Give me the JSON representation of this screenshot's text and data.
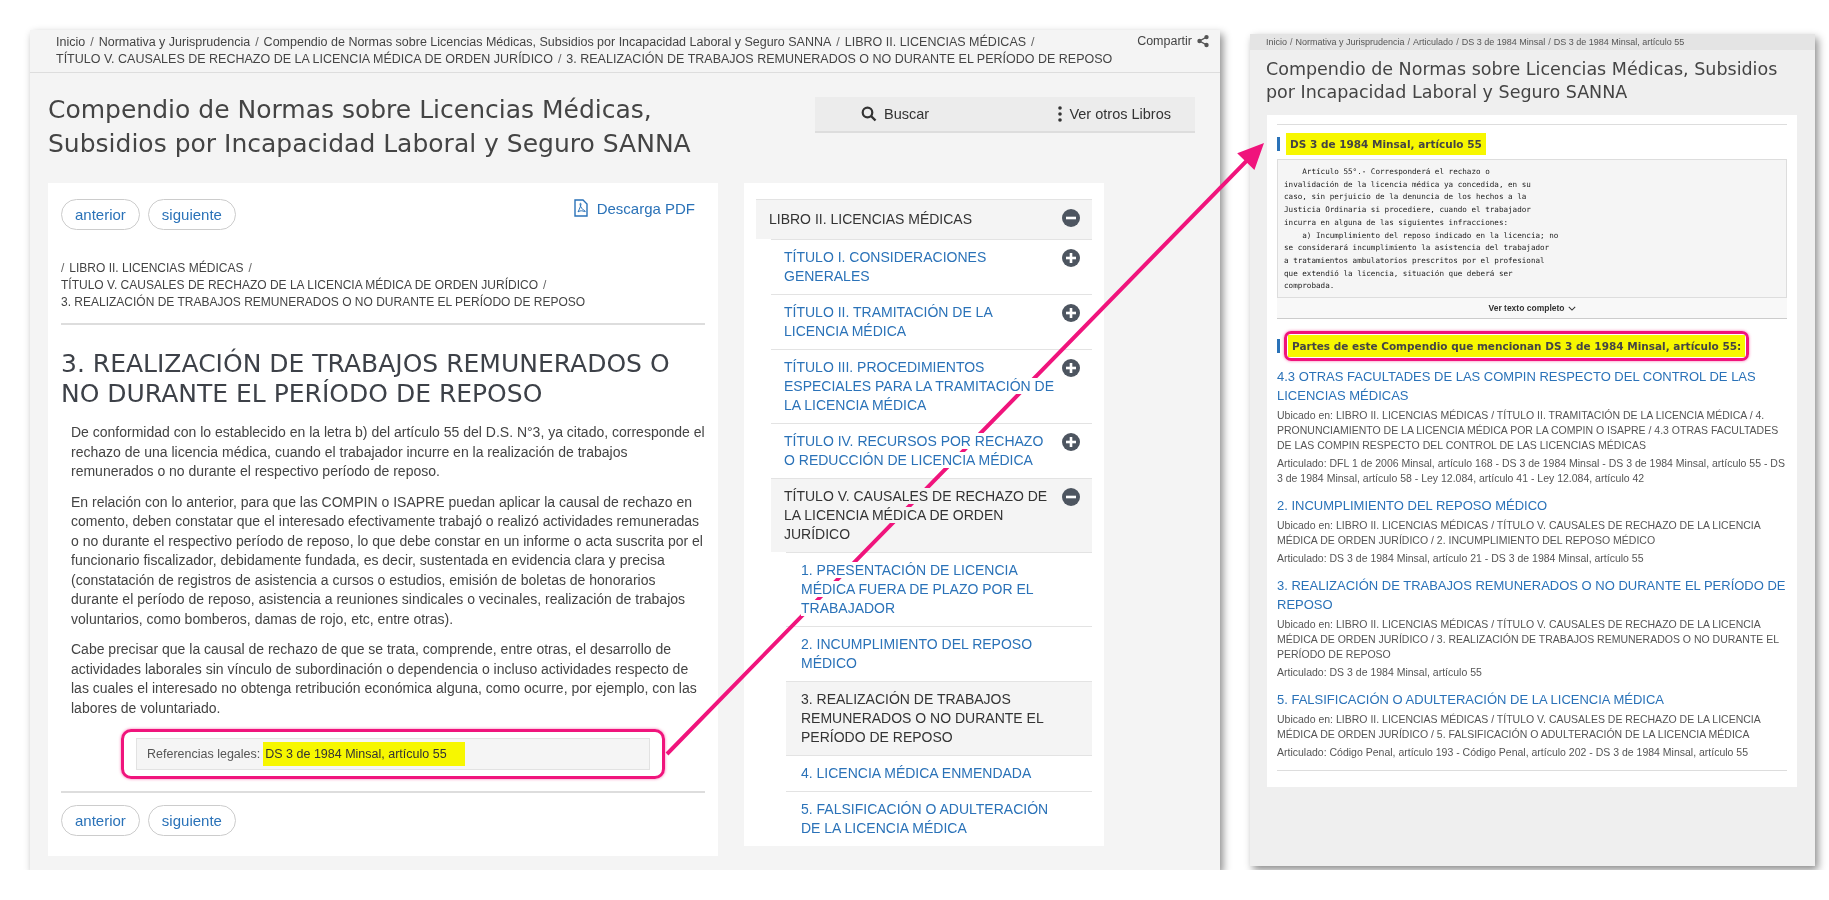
{
  "annotation_arrow": true,
  "left_page": {
    "breadcrumb": {
      "separator": "/",
      "items": [
        "Inicio",
        "Normativa y Jurisprudencia",
        "Compendio de Normas sobre Licencias Médicas, Subsidios por Incapacidad Laboral y Seguro SANNA",
        "LIBRO II. LICENCIAS MÉDICAS",
        "TÍTULO V. CAUSALES DE RECHAZO DE LA LICENCIA MÉDICA DE ORDEN JURÍDICO",
        "3. REALIZACIÓN DE TRABAJOS REMUNERADOS O NO DURANTE EL PERÍODO DE REPOSO"
      ]
    },
    "share": "Compartir",
    "title": "Compendio de Normas sobre Licencias Médicas, Subsidios por Incapacidad Laboral y Seguro SANNA",
    "tools": [
      {
        "kind": "search",
        "label": "Buscar"
      },
      {
        "kind": "more",
        "label": "Ver otros Libros"
      }
    ],
    "content": {
      "nav_top": [
        "anterior",
        "siguiente"
      ],
      "download": "Descarga PDF",
      "breadcrumb": {
        "separator": "/",
        "leading_separator": true,
        "items": [
          "LIBRO II. LICENCIAS MÉDICAS",
          "TÍTULO V. CAUSALES DE RECHAZO DE LA LICENCIA MÉDICA DE ORDEN JURÍDICO",
          "3. REALIZACIÓN DE TRABAJOS REMUNERADOS O NO DURANTE EL PERÍODO DE REPOSO"
        ]
      },
      "heading": "3. REALIZACIÓN DE TRABAJOS REMUNERADOS O NO DURANTE EL PERÍODO DE REPOSO",
      "paragraphs": [
        "De conformidad con lo establecido en la letra b) del artículo 55 del D.S. N°3, ya citado, corresponde el rechazo de una licencia médica, cuando el trabajador incurre en la realización de trabajos remunerados o no durante el respectivo período de reposo.",
        "En relación con lo anterior, para que las COMPIN o ISAPRE puedan aplicar la causal de rechazo en comento, deben constatar que el interesado efectivamente trabajó o realizó actividades remuneradas o no durante el respectivo período de reposo, lo que debe constar en un informe o acta suscrita por el funcionario fiscalizador, debidamente fundada, es decir, sustentada en evidencia clara y precisa (constatación de registros de asistencia a cursos o estudios, emisión de boletas de honorarios durante el período de reposo, asistencia a reuniones sindicales o vecinales, realización de trabajos voluntarios, como bomberos, damas de rojo, etc, entre otras).",
        "Cabe precisar que la causal de rechazo de que se trata, comprende, entre otras, el desarrollo de actividades laborales sin vínculo de subordinación o dependencia o incluso actividades respecto de las cuales el interesado no obtenga retribución económica alguna, como ocurre, por ejemplo, con las labores de voluntariado."
      ],
      "references": {
        "label": "Referencias legales:",
        "link": "DS 3 de 1984 Minsal, artículo 55",
        "highlighted": true,
        "framed": true
      },
      "nav_bottom": [
        "anterior",
        "siguiente"
      ]
    },
    "sidebar": {
      "items": [
        {
          "label": "LIBRO II. LICENCIAS MÉDICAS",
          "expanded": true,
          "children": [
            {
              "label": "TÍTULO I. CONSIDERACIONES GENERALES",
              "expanded": false
            },
            {
              "label": "TÍTULO II. TRAMITACIÓN DE LA LICENCIA MÉDICA",
              "expanded": false
            },
            {
              "label": "TÍTULO III. PROCEDIMIENTOS ESPECIALES PARA LA TRAMITACIÓN DE LA LICENCIA MÉDICA",
              "expanded": false
            },
            {
              "label": "TÍTULO IV. RECURSOS POR RECHAZO O REDUCCIÓN DE LICENCIA MÉDICA",
              "expanded": false
            },
            {
              "label": "TÍTULO V. CAUSALES DE RECHAZO DE LA LICENCIA MÉDICA DE ORDEN JURÍDICO",
              "expanded": true,
              "children": [
                {
                  "label": "1. PRESENTACIÓN DE LICENCIA MÉDICA FUERA DE PLAZO POR EL TRABAJADOR",
                  "selected": false
                },
                {
                  "label": "2. INCUMPLIMIENTO DEL REPOSO MÉDICO",
                  "selected": false
                },
                {
                  "label": "3. REALIZACIÓN DE TRABAJOS REMUNERADOS O NO DURANTE EL PERÍODO DE REPOSO",
                  "selected": true
                },
                {
                  "label": "4. LICENCIA MÉDICA ENMENDADA",
                  "selected": false
                },
                {
                  "label": "5. FALSIFICACIÓN O ADULTERACIÓN DE LA LICENCIA MÉDICA",
                  "selected": false
                }
              ]
            }
          ]
        }
      ]
    }
  },
  "right_page": {
    "breadcrumb": {
      "separator": "/",
      "items": [
        "Inicio",
        "Normativa y Jurisprudencia",
        "Articulado",
        "DS 3 de 1984 Minsal",
        "DS 3 de 1984 Minsal, artículo 55"
      ]
    },
    "title": "Compendio de Normas sobre Licencias Médicas, Subsidios por Incapacidad Laboral y Seguro SANNA",
    "article": {
      "heading": "DS 3 de 1984 Minsal, artículo 55",
      "highlighted": true,
      "text": "    Artículo 55°.- Corresponderá el rechazo o\ninvalidación de la licencia médica ya concedida, en su\ncaso, sin perjuicio de la denuncia de los hechos a la\nJusticia Ordinaria si procediere, cuando el trabajador\nincurra en alguna de las siguientes infracciones:\n    a) Incumplimiento del reposo indicado en la licencia; no\nse considerará incumplimiento la asistencia del trabajador\na tratamientos ambulatorios prescritos por el profesional\nque extendió la licencia, situación que deberá ser\ncomprobada.",
      "expand_label": "Ver texto completo"
    },
    "mentions": {
      "heading": "Partes de este Compendio que mencionan DS 3 de 1984 Minsal, artículo 55:",
      "highlighted": true,
      "framed": true,
      "results": [
        {
          "title": "4.3 OTRAS FACULTADES DE LAS COMPIN RESPECTO DEL CONTROL DE LAS LICENCIAS MÉDICAS",
          "location": "Ubicado en: LIBRO II. LICENCIAS MÉDICAS / TÍTULO II. TRAMITACIÓN DE LA LICENCIA MÉDICA / 4. PRONUNCIAMIENTO DE LA LICENCIA MÉDICA POR LA COMPIN O ISAPRE / 4.3 OTRAS FACULTADES DE LAS COMPIN RESPECTO DEL CONTROL DE LAS LICENCIAS MÉDICAS",
          "articles": "Articulado: DFL 1 de 2006 Minsal, artículo 168 - DS 3 de 1984 Minsal - DS 3 de 1984 Minsal, artículo 55 - DS 3 de 1984 Minsal, artículo 58 - Ley 12.084, artículo 41 - Ley 12.084, artículo 42"
        },
        {
          "title": "2. INCUMPLIMIENTO DEL REPOSO MÉDICO",
          "location": "Ubicado en: LIBRO II. LICENCIAS MÉDICAS / TÍTULO V. CAUSALES DE RECHAZO DE LA LICENCIA MÉDICA DE ORDEN JURÍDICO / 2. INCUMPLIMIENTO DEL REPOSO MÉDICO",
          "articles": "Articulado: DS 3 de 1984 Minsal, artículo 21 - DS 3 de 1984 Minsal, artículo 55"
        },
        {
          "title": "3. REALIZACIÓN DE TRABAJOS REMUNERADOS O NO DURANTE EL PERÍODO DE REPOSO",
          "location": "Ubicado en: LIBRO II. LICENCIAS MÉDICAS / TÍTULO V. CAUSALES DE RECHAZO DE LA LICENCIA MÉDICA DE ORDEN JURÍDICO / 3. REALIZACIÓN DE TRABAJOS REMUNERADOS O NO DURANTE EL PERÍODO DE REPOSO",
          "articles": "Articulado: DS 3 de 1984 Minsal, artículo 55"
        },
        {
          "title": "5. FALSIFICACIÓN O ADULTERACIÓN DE LA LICENCIA MÉDICA",
          "location": "Ubicado en: LIBRO II. LICENCIAS MÉDICAS / TÍTULO V. CAUSALES DE RECHAZO DE LA LICENCIA MÉDICA DE ORDEN JURÍDICO / 5. FALSIFICACIÓN O ADULTERACIÓN DE LA LICENCIA MÉDICA",
          "articles": "Articulado: Código Penal, artículo 193 - Código Penal, artículo 202 - DS 3 de 1984 Minsal, artículo 55"
        }
      ]
    }
  }
}
